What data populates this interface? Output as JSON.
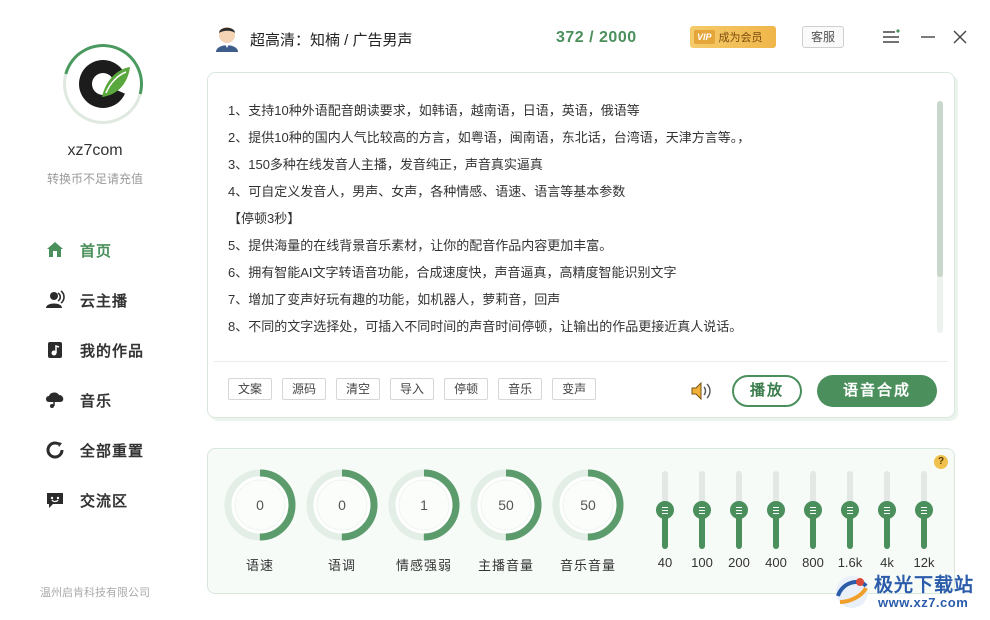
{
  "sidebar": {
    "brand": "xz7com",
    "subtitle": "转换币不足请充值",
    "items": [
      {
        "label": "首页"
      },
      {
        "label": "云主播"
      },
      {
        "label": "我的作品"
      },
      {
        "label": "音乐"
      },
      {
        "label": "全部重置"
      },
      {
        "label": "交流区"
      }
    ],
    "company": "温州启肯科技有限公司"
  },
  "header": {
    "voice": "超高清：知楠 / 广告男声",
    "counter": "372 / 2000",
    "vip_tag": "VIP",
    "vip_text": "成为会员",
    "service": "客服"
  },
  "editor": {
    "lines": [
      "1、支持10种外语配音朗读要求，如韩语，越南语，日语，英语，俄语等",
      "2、提供10种的国内人气比较高的方言，如粤语，闽南语，东北话，台湾语，天津方言等。，",
      "3、150多种在线发音人主播，发音纯正，声音真实逼真",
      "4、可自定义发音人，男声、女声，各种情感、语速、语言等基本参数",
      "【停顿3秒】",
      "5、提供海量的在线背景音乐素材，让你的配音作品内容更加丰富。",
      "6、拥有智能AI文字转语音功能，合成速度快，声音逼真，高精度智能识别文字",
      "7、增加了变声好玩有趣的功能，如机器人，萝莉音，回声",
      "8、不同的文字选择处，可插入不同时间的声音时间停顿，让输出的作品更接近真人说话。"
    ],
    "tools": [
      "文案",
      "源码",
      "清空",
      "导入",
      "停顿",
      "音乐",
      "变声"
    ],
    "play": "播放",
    "synth": "语音合成"
  },
  "knobs": [
    {
      "label": "语速",
      "value": "0",
      "fraction": 0.5
    },
    {
      "label": "语调",
      "value": "0",
      "fraction": 0.5
    },
    {
      "label": "情感强弱",
      "value": "1",
      "fraction": 0.5
    },
    {
      "label": "主播音量",
      "value": "50",
      "fraction": 0.5
    },
    {
      "label": "音乐音量",
      "value": "50",
      "fraction": 0.5
    }
  ],
  "equalizer": [
    {
      "label": "40",
      "level": 0.5
    },
    {
      "label": "100",
      "level": 0.5
    },
    {
      "label": "200",
      "level": 0.5
    },
    {
      "label": "400",
      "level": 0.5
    },
    {
      "label": "800",
      "level": 0.5
    },
    {
      "label": "1.6k",
      "level": 0.5
    },
    {
      "label": "4k",
      "level": 0.5
    },
    {
      "label": "12k",
      "level": 0.5
    }
  ],
  "help": "?",
  "watermark": {
    "title": "极光下载站",
    "url": "www.xz7.com"
  },
  "colors": {
    "accent": "#4a8f5c",
    "vip": "#f0b64a",
    "watermark": "#2a5caa"
  }
}
